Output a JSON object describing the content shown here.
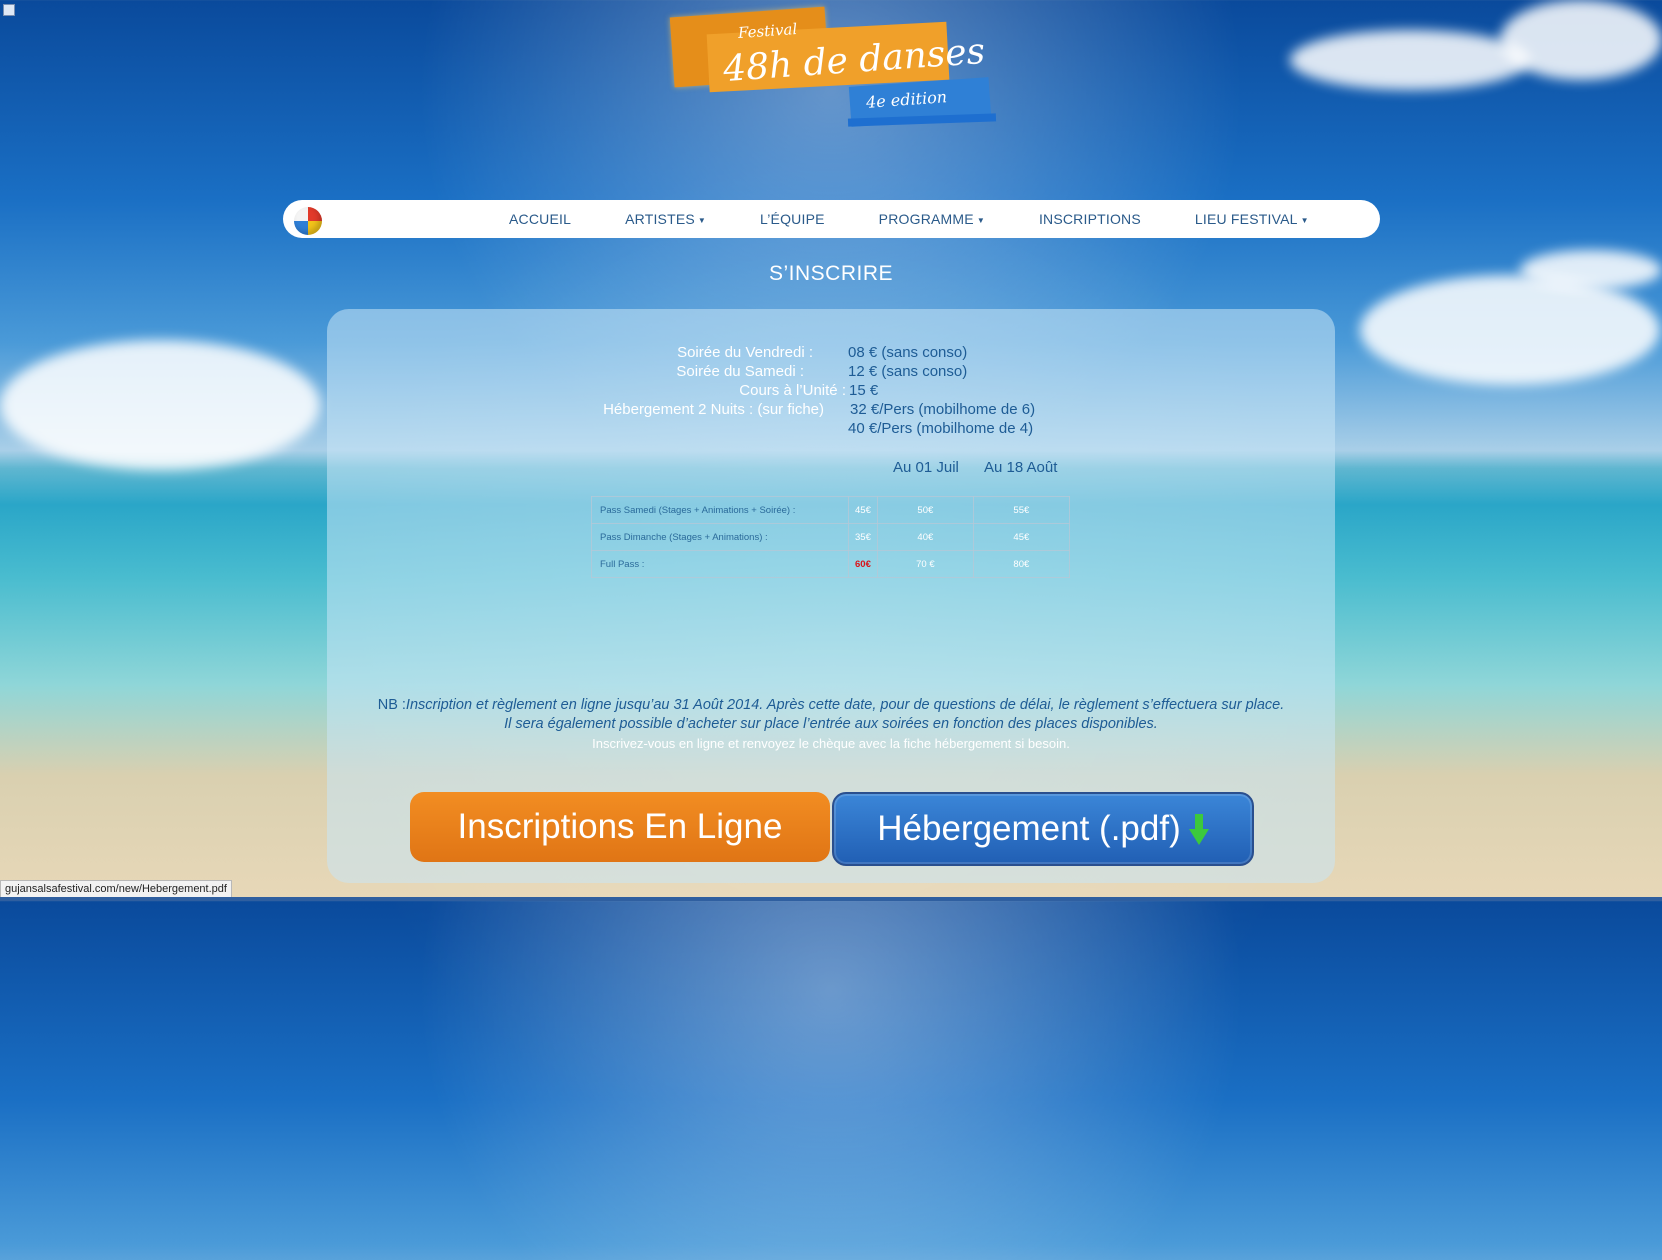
{
  "logo": {
    "festival": "Festival",
    "title": "48h de danses",
    "edition": "4e edition"
  },
  "nav": {
    "items": [
      {
        "label": "ACCUEIL",
        "dropdown": false
      },
      {
        "label": "ARTISTES",
        "dropdown": true
      },
      {
        "label": "L’ÉQUIPE",
        "dropdown": false
      },
      {
        "label": "PROGRAMME",
        "dropdown": true
      },
      {
        "label": "INSCRIPTIONS",
        "dropdown": false
      },
      {
        "label": "LIEU FESTIVAL",
        "dropdown": true
      }
    ]
  },
  "page_title": "S’INSCRIRE",
  "prices": [
    {
      "label": "Soirée du Vendredi :",
      "value": "08 € (sans conso)"
    },
    {
      "label": "Soirée du Samedi :",
      "value": "12 € (sans conso)"
    },
    {
      "label": "Cours à l’Unité :",
      "value": "15 €"
    },
    {
      "label": "Hébergement 2 Nuits : (sur fiche)",
      "value": "32 €/Pers (mobilhome de 6)"
    },
    {
      "label": "",
      "value": "40 €/Pers (mobilhome de 4)"
    }
  ],
  "columns": {
    "col1": "Au 01 Juil",
    "col2": "Au 18 Août"
  },
  "passes": [
    {
      "label": "Pass Samedi (Stages + Animations + Soirée) :",
      "p0": "45€",
      "p1": "50€",
      "p2": "55€"
    },
    {
      "label": "Pass Dimanche (Stages + Animations) :",
      "p0": "35€",
      "p1": "40€",
      "p2": "45€"
    },
    {
      "label": "Full Pass :",
      "p0": "60€",
      "p1": "70 €",
      "p2": "80€"
    }
  ],
  "nb": {
    "prefix": "NB :",
    "line1": "Inscription et règlement en ligne jusqu’au 31 Août 2014. Après cette date, pour de questions de délai, le règlement s’effectuera sur place.",
    "line2": "Il sera également possible d’acheter sur place l’entrée aux soirées en fonction des places disponibles.",
    "line3": "Inscrivez-vous en ligne et renvoyez le chèque avec la fiche hébergement si besoin."
  },
  "buttons": {
    "online": "Inscriptions En Ligne",
    "housing": "Hébergement (.pdf)"
  },
  "status_url": "gujansalsafestival.com/new/Hebergement.pdf",
  "colors": {
    "accent_orange": "#e07515",
    "accent_blue": "#215fb4",
    "text_blue": "#1e5c95"
  }
}
